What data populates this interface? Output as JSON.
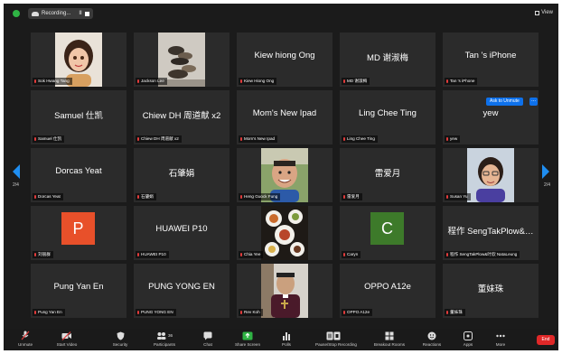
{
  "topbar": {
    "recording_label": "Recording...",
    "pause_glyph": "II",
    "view_label": "View"
  },
  "navigation": {
    "left_page": "2/4",
    "right_page": "2/4"
  },
  "tiles": [
    {
      "display": "",
      "label": "Sok Hwang Tang",
      "kind": "photo",
      "photo": "woman-avatar"
    },
    {
      "display": "",
      "label": "Jackson Lee",
      "kind": "photo",
      "photo": "balanced-stones"
    },
    {
      "display": "Kiew hiong Ong",
      "label": "Kiew Hiong Ong",
      "kind": "text"
    },
    {
      "display": "MD 谢淑梅",
      "label": "MD 谢淑梅",
      "kind": "text"
    },
    {
      "display": "Tan 's iPhone",
      "label": "Tan 's iPhone",
      "kind": "text"
    },
    {
      "display": "Samuel 仕凯",
      "label": "Samuel 仕凯",
      "kind": "text"
    },
    {
      "display": "Chiew DH 周道献 x2",
      "label": "Chiew DH 周道献 x2",
      "kind": "text"
    },
    {
      "display": "Mom's New Ipad",
      "label": "Mom's New Ipad",
      "kind": "text"
    },
    {
      "display": "Ling Chee Ting",
      "label": "Ling Chee Ting",
      "kind": "text"
    },
    {
      "display": "yew",
      "label": "yew",
      "kind": "text"
    },
    {
      "display": "Dorcas Yeat",
      "label": "Dorcas Yeat",
      "kind": "text"
    },
    {
      "display": "石肇娟",
      "label": "石肇娟",
      "kind": "text"
    },
    {
      "display": "",
      "label": "Heng Guock Fung",
      "kind": "photo",
      "photo": "man-smiling"
    },
    {
      "display": "雷爱月",
      "label": "雷爱月",
      "kind": "text"
    },
    {
      "display": "",
      "label": "Susan Yu",
      "kind": "photo",
      "photo": "woman-glasses"
    },
    {
      "display": "P",
      "label": "刘丽群",
      "kind": "avatar",
      "avatar_color": "#e8502a"
    },
    {
      "display": "HUAWEI P10",
      "label": "HUAWEI P10",
      "kind": "text"
    },
    {
      "display": "",
      "label": "Chia Yee",
      "kind": "photo",
      "photo": "food-table"
    },
    {
      "display": "C",
      "label": "Caryn",
      "kind": "avatar",
      "avatar_color": "#3d7a2a"
    },
    {
      "display": "程作 SengTakPlow&…",
      "label": "程作 SengTakPlow&叶欣 NataLeung",
      "kind": "text"
    },
    {
      "display": "Pung Yan En",
      "label": "Pung Yan En",
      "kind": "text"
    },
    {
      "display": "PUNG YONG EN",
      "label": "PUNG YONG EN",
      "kind": "text"
    },
    {
      "display": "",
      "label": "Rev Koh",
      "kind": "photo",
      "photo": "man-pastor"
    },
    {
      "display": "OPPO A12e",
      "label": "OPPO A12e",
      "kind": "text"
    },
    {
      "display": "董妹珠",
      "label": "董妹珠",
      "kind": "text"
    }
  ],
  "ask_unmute": {
    "label": "Ask to Unmute",
    "more": "..."
  },
  "toolbar": {
    "unmute": "Unmute",
    "start_video": "Start Video",
    "security": "Security",
    "participants": "Participants",
    "participants_count": "36",
    "chat": "Chat",
    "share_screen": "Share Screen",
    "polls": "Polls",
    "pause_recording": "Pause/Stop Recording",
    "breakout_rooms": "Breakout Rooms",
    "reactions": "Reactions",
    "apps": "Apps",
    "more": "More",
    "end": "End"
  },
  "colors": {
    "accent_green": "#2fb344",
    "accent_blue": "#0e71eb",
    "end_red": "#e02828"
  }
}
